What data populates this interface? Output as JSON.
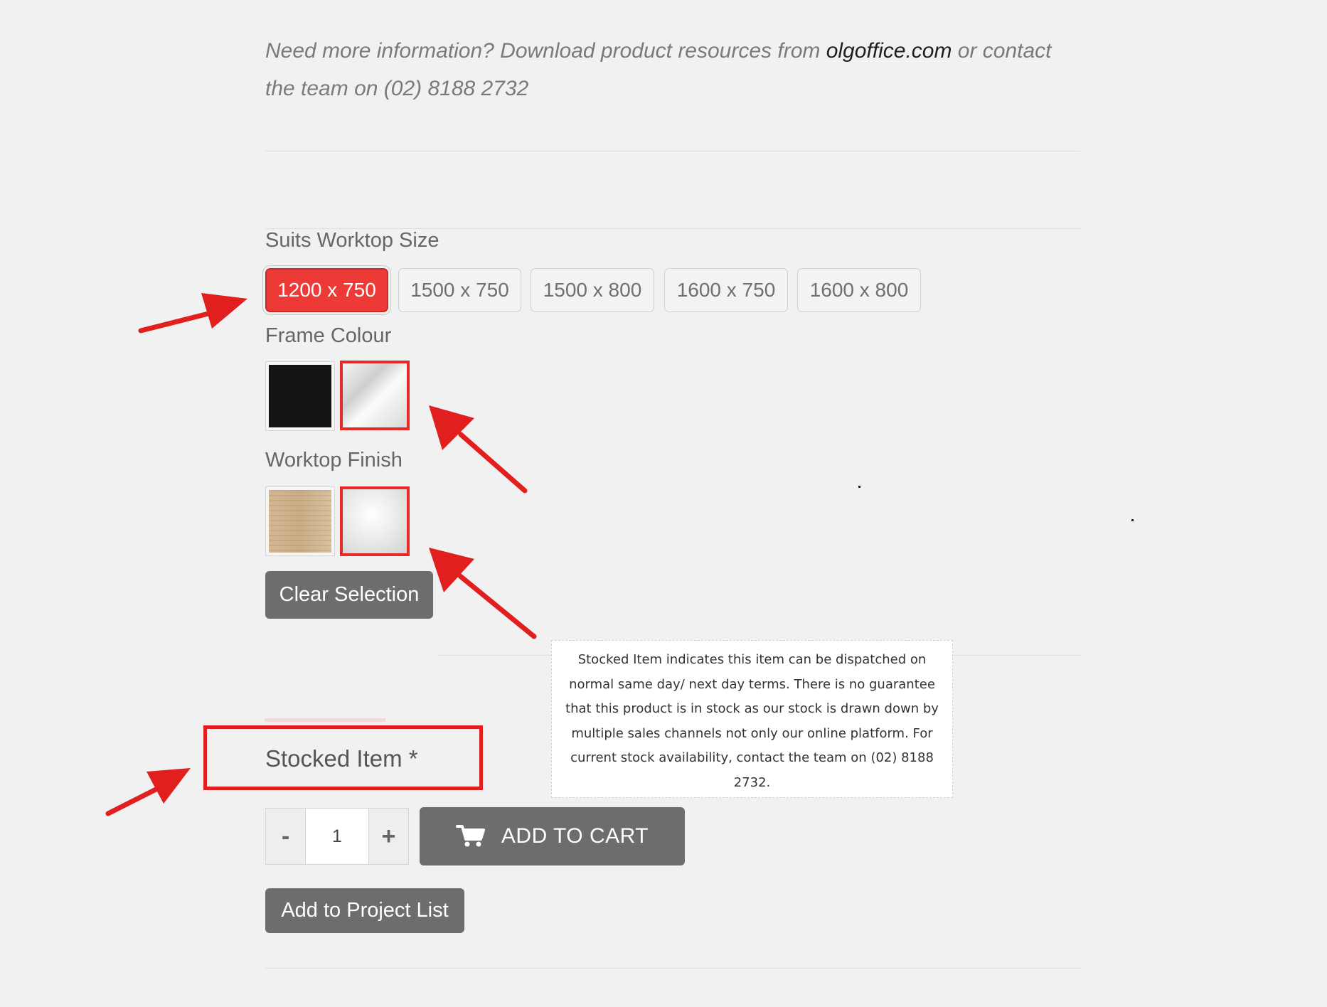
{
  "info": {
    "text_before": "Need more information? Download product resources from ",
    "link": "olgoffice.com",
    "text_after": " or contact the team on (02) 8188 2732"
  },
  "worktop_size": {
    "label": "Suits Worktop Size",
    "options": [
      "1200 x 750",
      "1500 x 750",
      "1500 x 800",
      "1600 x 750",
      "1600 x 800"
    ],
    "selected": "1200 x 750"
  },
  "frame_colour": {
    "label": "Frame Colour",
    "swatches": [
      "black",
      "white"
    ],
    "highlighted": "white"
  },
  "worktop_finish": {
    "label": "Worktop Finish",
    "swatches": [
      "oak",
      "white"
    ],
    "highlighted": "white"
  },
  "clear_selection_label": "Clear Selection",
  "tooltip_text": "Stocked Item indicates this item can be dispatched on normal same day/ next day terms. There is no guarantee that this product is in stock as our stock is drawn down by multiple sales channels not only our online platform. For current stock availability, contact the team on (02) 8188 2732.",
  "stocked_item_label": "Stocked Item *",
  "quantity": {
    "minus": "-",
    "value": "1",
    "plus": "+"
  },
  "add_to_cart_label": "ADD TO CART",
  "add_to_project_label": "Add to Project List",
  "colors": {
    "accent": "#ee3a36",
    "annotation": "#e21f1f",
    "button": "#6d6d6d"
  }
}
